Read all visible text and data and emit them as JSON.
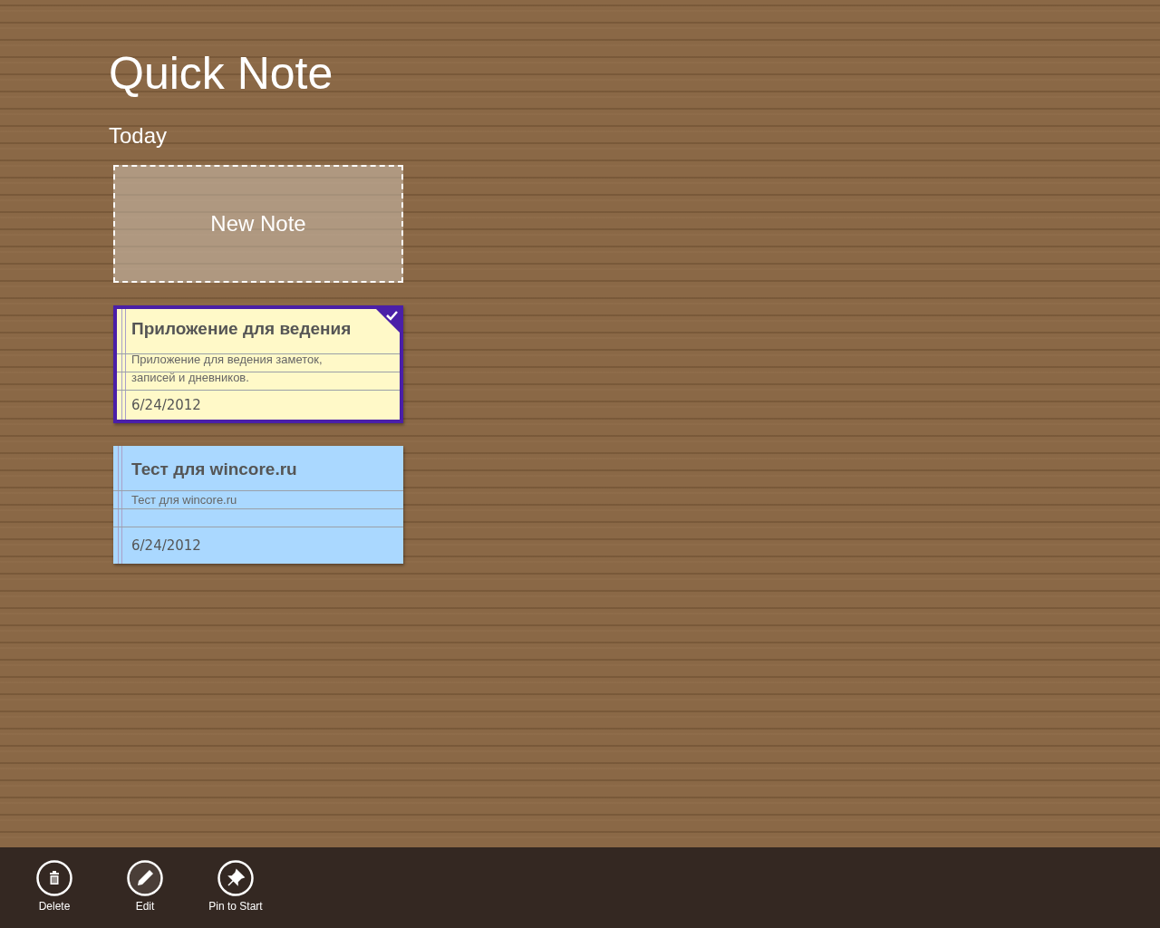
{
  "app": {
    "title": "Quick Note"
  },
  "group": {
    "label": "Today"
  },
  "new_note": {
    "label": "New Note"
  },
  "notes": [
    {
      "title": "Приложение для ведения",
      "body": "Приложение для ведения заметок, записей и дневников.",
      "date": "6/24/2012",
      "color": "#fff9c8",
      "selected": true
    },
    {
      "title": "Тест для wincore.ru",
      "body": "Тест для wincore.ru",
      "date": "6/24/2012",
      "color": "#aad8ff",
      "selected": false
    }
  ],
  "app_bar": [
    {
      "label": "Delete",
      "kind": "delete"
    },
    {
      "label": "Edit",
      "kind": "edit"
    },
    {
      "label": "Pin to Start",
      "kind": "pin"
    }
  ]
}
